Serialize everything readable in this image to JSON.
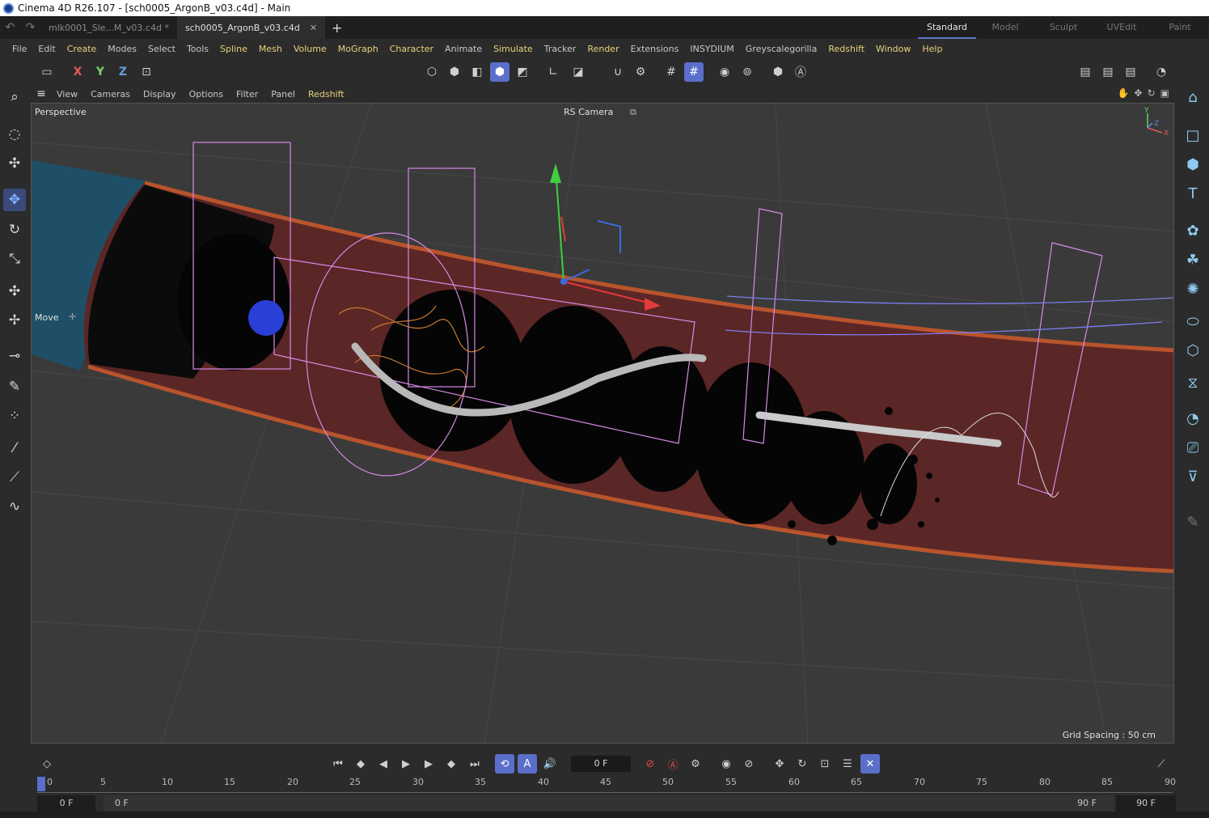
{
  "window": {
    "title": "Cinema 4D R26.107 - [sch0005_ArgonB_v03.c4d] - Main"
  },
  "doc_tabs": [
    {
      "label": "mlk0001_Sle...M_v03.c4d *"
    },
    {
      "label": "sch0005_ArgonB_v03.c4d"
    }
  ],
  "layouts": [
    "Standard",
    "Model",
    "Sculpt",
    "UVEdit",
    "Paint"
  ],
  "menu": [
    "File",
    "Edit",
    "Create",
    "Modes",
    "Select",
    "Tools",
    "Spline",
    "Mesh",
    "Volume",
    "MoGraph",
    "Character",
    "Animate",
    "Simulate",
    "Tracker",
    "Render",
    "Extensions",
    "INSYDIUM",
    "Greyscalegorilla",
    "Redshift",
    "Window",
    "Help"
  ],
  "toolbar": {
    "x_label": "X",
    "y_label": "Y",
    "z_label": "Z"
  },
  "viewport_menu": [
    "View",
    "Cameras",
    "Display",
    "Options",
    "Filter",
    "Panel",
    "Redshift"
  ],
  "viewport": {
    "view_name": "Perspective",
    "camera_name": "RS Camera",
    "tool_name": "Move",
    "grid_spacing": "Grid Spacing : 50 cm",
    "axis_y": "Y",
    "axis_z": "Z",
    "axis_x": "X"
  },
  "timeline": {
    "current_frame": "0 F",
    "ruler_labels": [
      "0",
      "5",
      "10",
      "15",
      "20",
      "25",
      "30",
      "35",
      "40",
      "45",
      "50",
      "55",
      "60",
      "65",
      "70",
      "75",
      "80",
      "85",
      "90"
    ],
    "range_start": "0 F",
    "range_min": "0 F",
    "range_max": "90 F",
    "range_end": "90 F"
  },
  "colors": {
    "accent": "#5a6fc9",
    "menu_accent": "#e8d27a",
    "pipe": "#8a3a3a",
    "wire": "#d58ae6"
  }
}
